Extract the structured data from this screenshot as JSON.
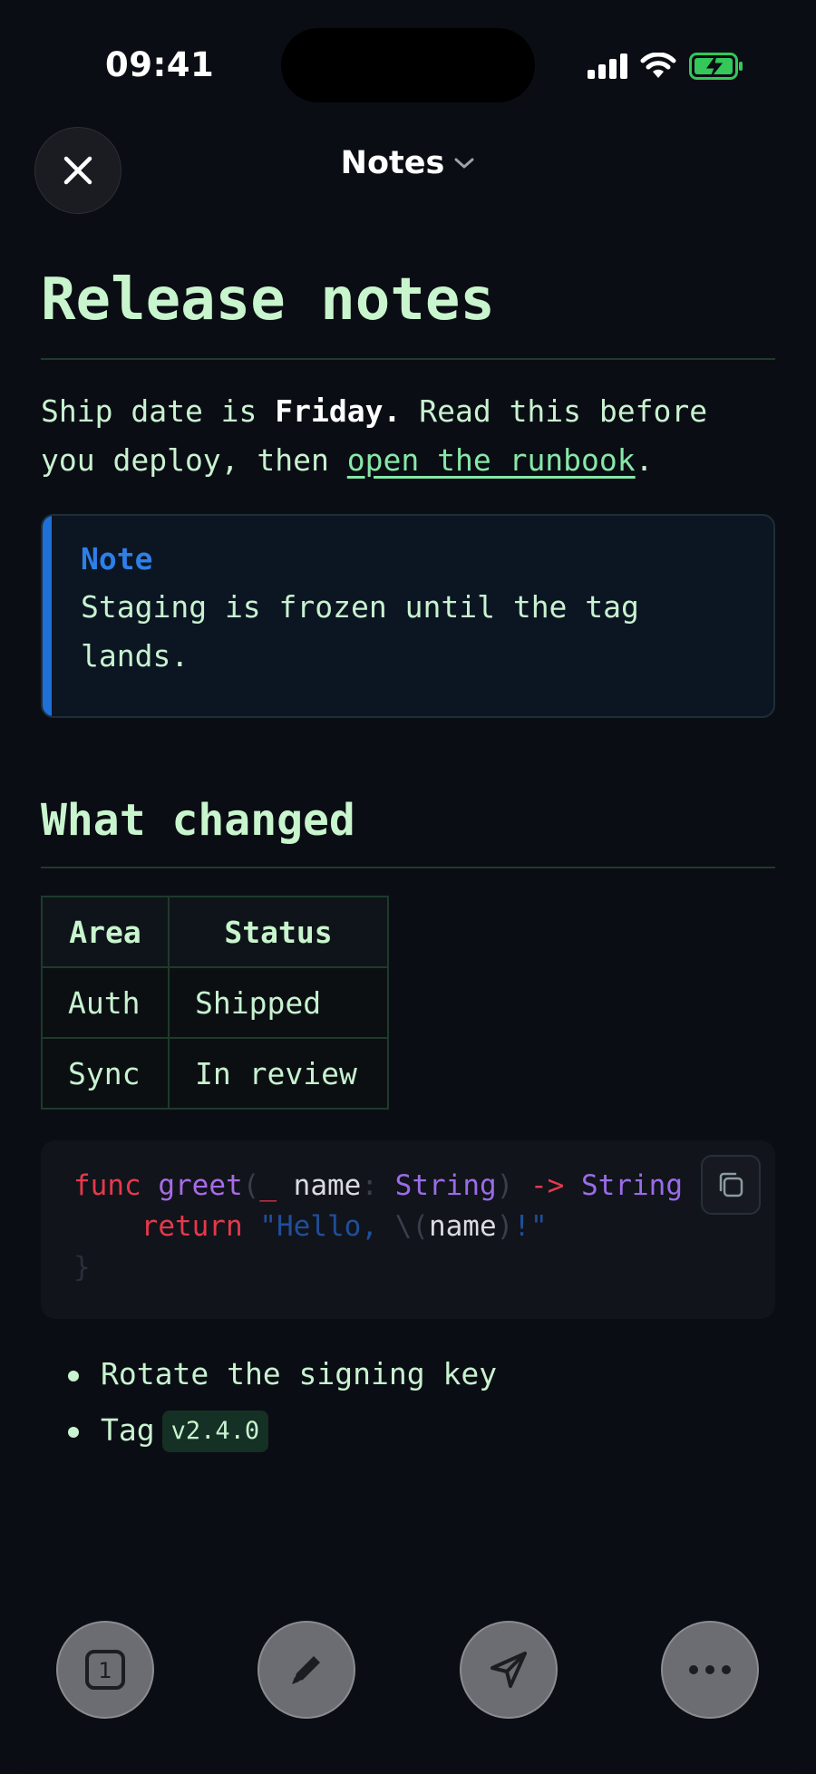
{
  "status_bar": {
    "time": "09:41",
    "icons": [
      "cellular-signal-icon",
      "wifi-icon",
      "battery-charging-icon"
    ],
    "battery_color": "#34c759"
  },
  "header": {
    "title": "Notes",
    "close_icon": "close-icon",
    "dropdown_icon": "chevron-down-icon"
  },
  "document": {
    "title": "Release notes",
    "intro": {
      "part1": "Ship date is ",
      "bold": "Friday.",
      "part2": " Read this before you deploy, then ",
      "link": "open the runbook",
      "part3": "."
    },
    "callout": {
      "title": "Note",
      "body": "Staging is frozen until the tag lands.",
      "accent_color": "#1f6fd8"
    },
    "section_heading": "What changed",
    "table": {
      "headers": [
        "Area",
        "Status"
      ],
      "rows": [
        [
          "Auth",
          "Shipped"
        ],
        [
          "Sync",
          "In review"
        ]
      ]
    },
    "code": {
      "line1": {
        "kw": "func",
        "fn": "greet",
        "p1": "(",
        "underscore": "_",
        "param": "name",
        "colon": ":",
        "type1": "String",
        "p2": ")",
        "arrow": "->",
        "type2": "String"
      },
      "line2": {
        "kw": "return",
        "str1": "\"Hello, ",
        "interp_open": "\\(",
        "interp": "name",
        "interp_close": ")",
        "str2": "!\""
      },
      "line3": "}",
      "copy_icon": "copy-icon"
    },
    "bullets": {
      "item1": "Rotate the signing key",
      "item2_text": "Tag",
      "item2_code": "v2.4.0"
    }
  },
  "toolbar": {
    "tabs_count": "1",
    "buttons": [
      "tabs-icon",
      "pencil-icon",
      "send-icon",
      "more-icon"
    ]
  }
}
